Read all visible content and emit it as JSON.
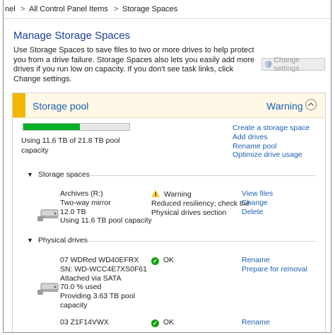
{
  "breadcrumb": {
    "leading": "nel",
    "separator": ">",
    "items": [
      "All Control Panel Items",
      "Storage Spaces"
    ]
  },
  "page": {
    "title": "Manage Storage Spaces",
    "description": "Use Storage Spaces to save files to two or more drives to help protect you from a drive failure. Storage Spaces also lets you easily add more drives if you run low on capacity. If you don't see task links, click Change settings.",
    "change_settings_label": "Change settings",
    "change_settings_icon": "shield-icon"
  },
  "pool": {
    "title": "Storage pool",
    "status": "Warning",
    "accent_color": "#f3b700",
    "usage_fraction": 0.53,
    "usage_text": "Using 11.6 TB of 21.8 TB pool capacity",
    "tasks": [
      "Create a storage space",
      "Add drives",
      "Rename pool",
      "Optimize drive usage"
    ]
  },
  "storage_spaces": {
    "heading": "Storage spaces",
    "items": [
      {
        "lines": [
          "Archives (R:)",
          "Two-way mirror",
          "12.0 TB",
          "Using 11.6 TB pool capacity"
        ],
        "status": "Warning",
        "status_icon": "warning-icon",
        "status_detail": [
          "Reduced resiliency; check the",
          "Physical drives section"
        ],
        "actions": [
          "View files",
          "Change",
          "Delete"
        ]
      }
    ]
  },
  "physical_drives": {
    "heading": "Physical drives",
    "items": [
      {
        "lines": [
          "07 WDRed WD40EFRX",
          "SN: WD-WCC4E7XS0F61",
          "Attached via SATA",
          "70.0 % used",
          "Providing 3.63 TB pool",
          "capacity"
        ],
        "status": "OK",
        "status_icon": "check-icon",
        "actions": [
          "Rename",
          "Prepare for removal"
        ]
      },
      {
        "lines": [
          "03 Z1F14VWX"
        ],
        "status": "OK",
        "status_icon": "check-icon",
        "actions": [
          "Rename"
        ]
      }
    ]
  },
  "colors": {
    "link": "#1a5fb4",
    "title": "#1c3f95",
    "progress": "#06b025",
    "ok": "#13a10e",
    "warning": "#ffc83d"
  }
}
